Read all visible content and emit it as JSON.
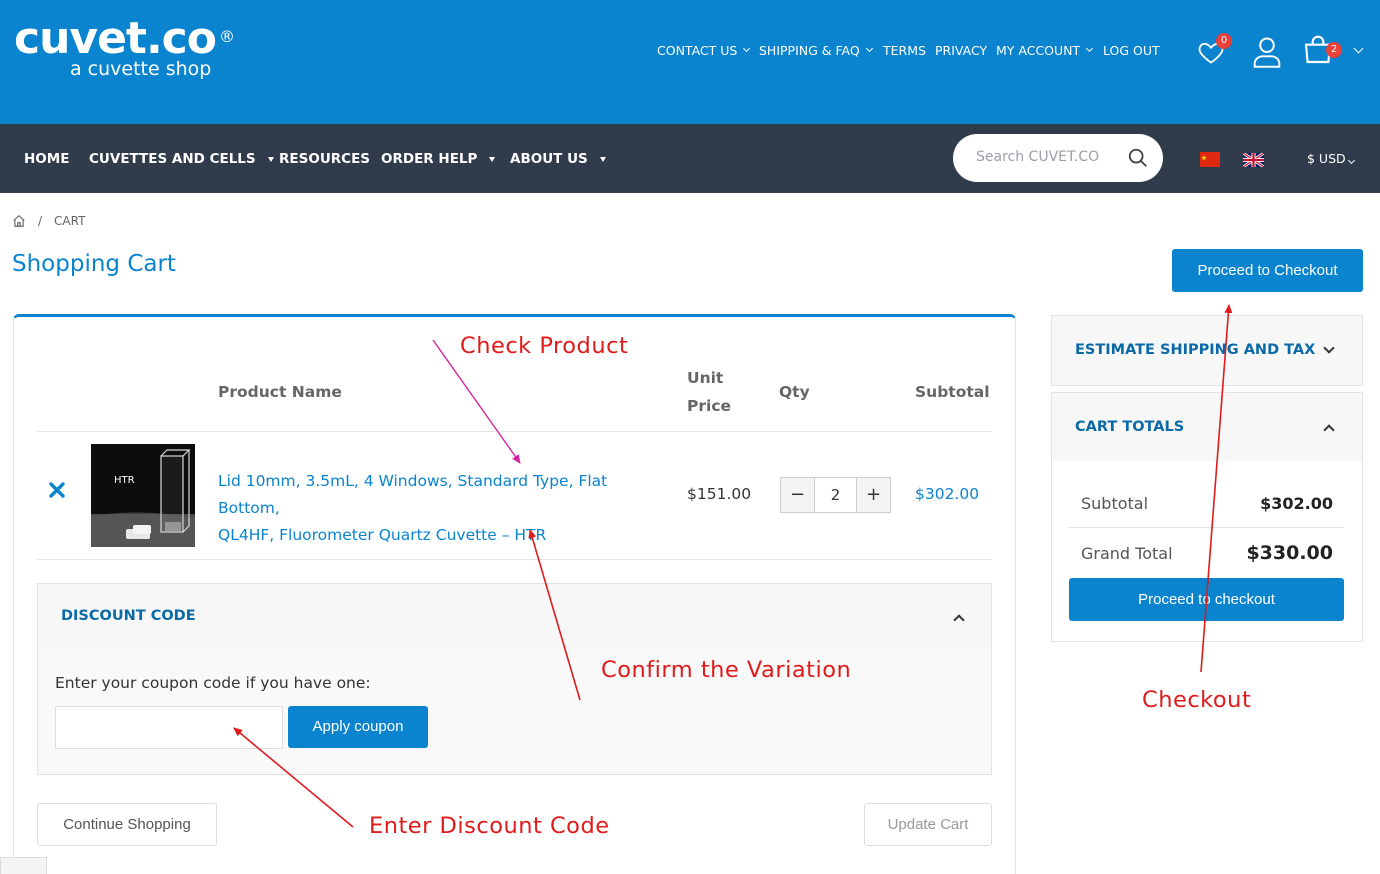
{
  "logo": {
    "main": "cuvet.co",
    "registered": "®",
    "tagline": "a cuvette shop"
  },
  "top_nav": [
    {
      "label": "CONTACT US",
      "has_dropdown": true
    },
    {
      "label": "SHIPPING & FAQ",
      "has_dropdown": true
    },
    {
      "label": "TERMS",
      "has_dropdown": false
    },
    {
      "label": "PRIVACY",
      "has_dropdown": false
    },
    {
      "label": "MY ACCOUNT",
      "has_dropdown": true
    },
    {
      "label": "LOG OUT",
      "has_dropdown": false
    }
  ],
  "header_icons": {
    "wishlist_icon": "heart-icon",
    "wishlist_count": "0",
    "account_icon": "user-icon",
    "cart_icon": "shopping-bag-icon",
    "cart_count": "2"
  },
  "main_nav": [
    {
      "label": "HOME",
      "has_dropdown": false
    },
    {
      "label": "CUVETTES AND CELLS",
      "has_dropdown": true
    },
    {
      "label": "RESOURCES",
      "has_dropdown": false
    },
    {
      "label": "ORDER HELP",
      "has_dropdown": true
    },
    {
      "label": "ABOUT US",
      "has_dropdown": true
    }
  ],
  "search": {
    "placeholder": "Search CUVET.CO",
    "icon": "search-icon"
  },
  "currency": "$ USD",
  "breadcrumb": {
    "home_icon": "home-icon",
    "separator": "/",
    "current": "CART"
  },
  "page_title": "Shopping Cart",
  "proceed_top_label": "Proceed to Checkout",
  "cart_table": {
    "headers": {
      "product": "Product Name",
      "unit_price_1": "Unit",
      "unit_price_2": "Price",
      "qty": "Qty",
      "subtotal": "Subtotal"
    },
    "items": [
      {
        "thumbnail_label": "HTR",
        "name_line1": "Lid 10mm, 3.5mL, 4 Windows, Standard Type, Flat Bottom,",
        "name_line2": "QL4HF, Fluorometer Quartz Cuvette – HTR",
        "unit_price": "$151.00",
        "qty": "2",
        "subtotal": "$302.00"
      }
    ],
    "qty_minus": "−",
    "qty_plus": "+",
    "remove_icon": "close-icon"
  },
  "discount": {
    "heading": "DISCOUNT CODE",
    "prompt": "Enter your coupon code if you have one:",
    "input_value": "",
    "apply_label": "Apply coupon"
  },
  "actions": {
    "continue_label": "Continue Shopping",
    "update_label": "Update Cart"
  },
  "sidebar": {
    "estimate_heading": "ESTIMATE SHIPPING AND TAX",
    "totals_heading": "CART TOTALS",
    "subtotal_label": "Subtotal",
    "subtotal_value": "$302.00",
    "grand_total_label": "Grand Total",
    "grand_total_value": "$330.00",
    "checkout_label": "Proceed to checkout"
  },
  "annotations": {
    "check_product": "Check Product",
    "confirm_variation": "Confirm the Variation",
    "enter_discount": "Enter Discount Code",
    "checkout": "Checkout",
    "arrow_color_primary": "#e01b1b",
    "arrow_color_secondary": "#d6249f"
  },
  "colors": {
    "brand_blue": "#0a84cf",
    "nav_dark": "#303c4b",
    "badge_red": "#e8413a"
  }
}
